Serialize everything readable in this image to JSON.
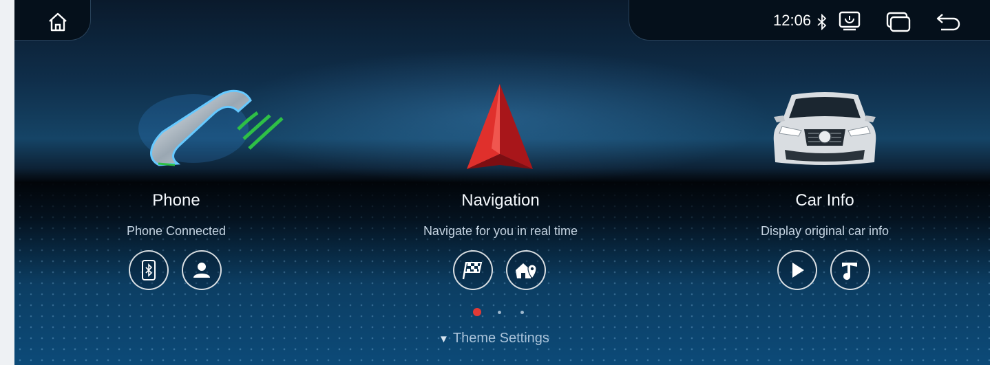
{
  "status_bar": {
    "time": "12:06",
    "home_icon": "home-icon",
    "bluetooth_icon": "bluetooth-icon",
    "screen_icon": "screen-mirror-icon",
    "windows_icon": "multi-window-icon",
    "back_icon": "back-icon"
  },
  "apps": [
    {
      "title": "Phone",
      "subtitle": "Phone Connected",
      "image": "phone-handset-icon",
      "buttons": [
        "phone-bluetooth-icon",
        "contacts-icon"
      ]
    },
    {
      "title": "Navigation",
      "subtitle": "Navigate for you in real time",
      "image": "navigation-arrow-icon",
      "buttons": [
        "checkered-flag-icon",
        "home-location-icon"
      ]
    },
    {
      "title": "Car Info",
      "subtitle": "Display original car info",
      "image": "car-front-icon",
      "buttons": [
        "play-icon",
        "music-note-icon"
      ]
    }
  ],
  "pager": {
    "total": 3,
    "active": 1
  },
  "theme_settings_label": "Theme Settings",
  "colors": {
    "accent_red": "#e0302c",
    "pager_active": "#e23a36",
    "green_signal": "#2ec046"
  }
}
